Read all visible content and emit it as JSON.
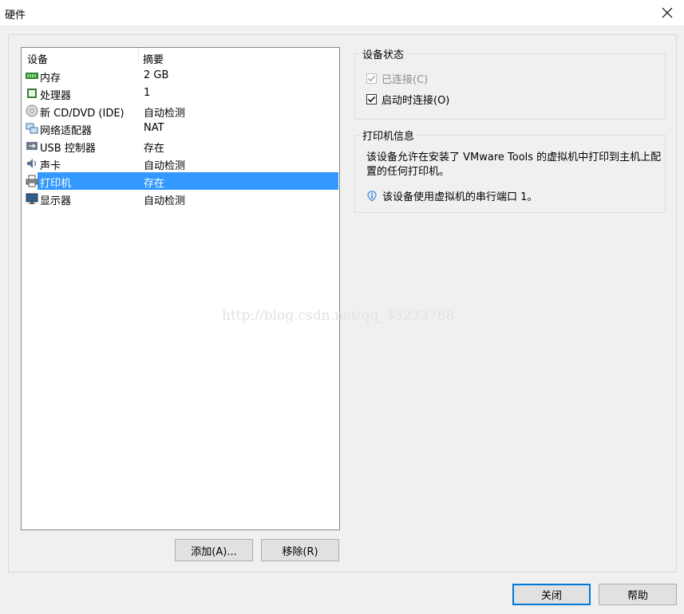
{
  "window": {
    "title": "硬件"
  },
  "device_list": {
    "headers": {
      "device": "设备",
      "summary": "摘要"
    },
    "rows": [
      {
        "name": "内存",
        "summary": "2 GB",
        "icon": "memory-icon"
      },
      {
        "name": "处理器",
        "summary": "1",
        "icon": "processor-icon"
      },
      {
        "name": "新 CD/DVD (IDE)",
        "summary": "自动检测",
        "icon": "cd-dvd-icon"
      },
      {
        "name": "网络适配器",
        "summary": "NAT",
        "icon": "network-adapter-icon"
      },
      {
        "name": "USB 控制器",
        "summary": "存在",
        "icon": "usb-icon"
      },
      {
        "name": "声卡",
        "summary": "自动检测",
        "icon": "sound-card-icon"
      },
      {
        "name": "打印机",
        "summary": "存在",
        "icon": "printer-icon"
      },
      {
        "name": "显示器",
        "summary": "自动检测",
        "icon": "display-icon"
      }
    ],
    "selected_index": 6
  },
  "buttons": {
    "add": "添加(A)...",
    "remove": "移除(R)",
    "close": "关闭",
    "help": "帮助"
  },
  "device_status": {
    "legend": "设备状态",
    "connected_label": "已连接(C)",
    "connected_checked": true,
    "connected_enabled": false,
    "connect_at_power_on_label": "启动时连接(O)",
    "connect_at_power_on_checked": true
  },
  "printer_info": {
    "legend": "打印机信息",
    "description": "该设备允许在安装了 VMware Tools 的虚拟机中打印到主机上配置的任何打印机。",
    "note": "该设备使用虚拟机的串行端口 1。"
  },
  "watermark": "http://blog.csdn.net/qq_33233768",
  "colors": {
    "selection": "#3399ff",
    "default_button_border": "#0078d7"
  }
}
